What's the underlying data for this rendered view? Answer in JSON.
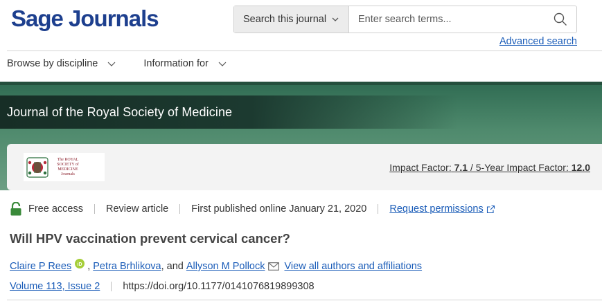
{
  "header": {
    "logo_text": "Sage Journals",
    "search": {
      "scope_label": "Search this journal",
      "placeholder": "Enter search terms..."
    },
    "advanced_search": "Advanced search"
  },
  "nav": {
    "items": [
      {
        "label": "Browse by discipline"
      },
      {
        "label": "Information for"
      }
    ]
  },
  "journal": {
    "title": "Journal of the Royal Society of Medicine",
    "logo_text": "The ROYAL SOCIETY of MEDICINE Journals",
    "impact_label": "Impact Factor:",
    "impact_value": "7.1",
    "five_year_label": "/ 5-Year Impact Factor:",
    "five_year_value": "12.0"
  },
  "article": {
    "access": "Free access",
    "type": "Review article",
    "published": "First published online January 21, 2020",
    "permissions": "Request permissions",
    "title": "Will HPV vaccination prevent cervical cancer?",
    "authors": [
      {
        "name": "Claire P Rees"
      },
      {
        "name": "Petra Brhlikova"
      },
      {
        "name": "Allyson M Pollock"
      }
    ],
    "author_sep_1": ", ",
    "author_sep_2": ", and ",
    "view_all": "View all authors and affiliations",
    "volume": "Volume 113, Issue 2",
    "doi": "https://doi.org/10.1177/0141076819899308"
  },
  "colors": {
    "brand_blue": "#1d3f8e",
    "link_blue": "#1a5cb8",
    "hero_green": "#4f8a6d",
    "access_green": "#3a8a3a",
    "orcid_green": "#a6ce39"
  },
  "icons": {
    "search": "search-icon",
    "chevron": "chevron-down-icon",
    "lock": "lock-open-icon",
    "external": "external-link-icon",
    "orcid": "orcid-icon",
    "mail": "mail-icon"
  }
}
